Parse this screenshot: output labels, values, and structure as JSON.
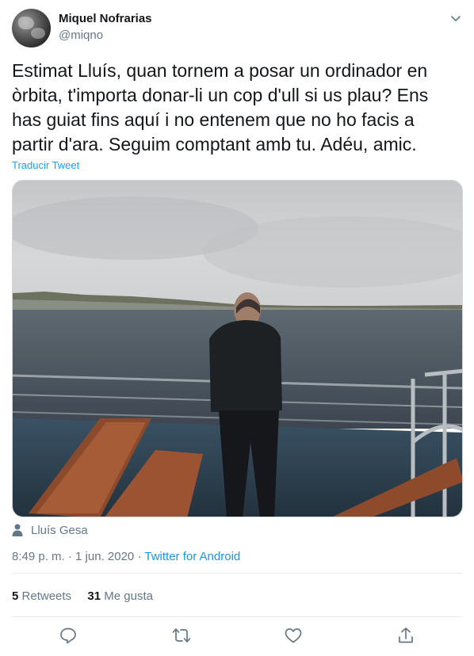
{
  "author": {
    "name": "Miquel Nofrarias",
    "handle": "@miqno"
  },
  "tweet": {
    "text_lines": [
      "Estimat Lluís, quan tornem a posar un ordinador en",
      "òrbita, t'importa donar-li un cop d'ull si us plau? Ens",
      "has guiat fins aquí i no entenem que no ho facis a",
      "partir d'ara. Seguim comptant amb tu. Adéu, amic."
    ],
    "translate_label": "Traducir Tweet",
    "tagged_person": "Lluís Gesa",
    "time": "8:49 p. m.",
    "sep": "·",
    "date": "1 jun. 2020",
    "source": "Twitter for Android"
  },
  "stats": {
    "retweets_count": "5",
    "retweets_label": "Retweets",
    "likes_count": "31",
    "likes_label": "Me gusta"
  },
  "icons": {
    "caret": "chevron-down-icon",
    "tag": "person-icon",
    "reply": "reply-icon",
    "retweet": "retweet-icon",
    "like": "heart-icon",
    "share": "share-icon"
  },
  "colors": {
    "accent": "#1da1f2",
    "muted": "#657786",
    "text": "#14171a",
    "border": "#e6ecf0"
  }
}
